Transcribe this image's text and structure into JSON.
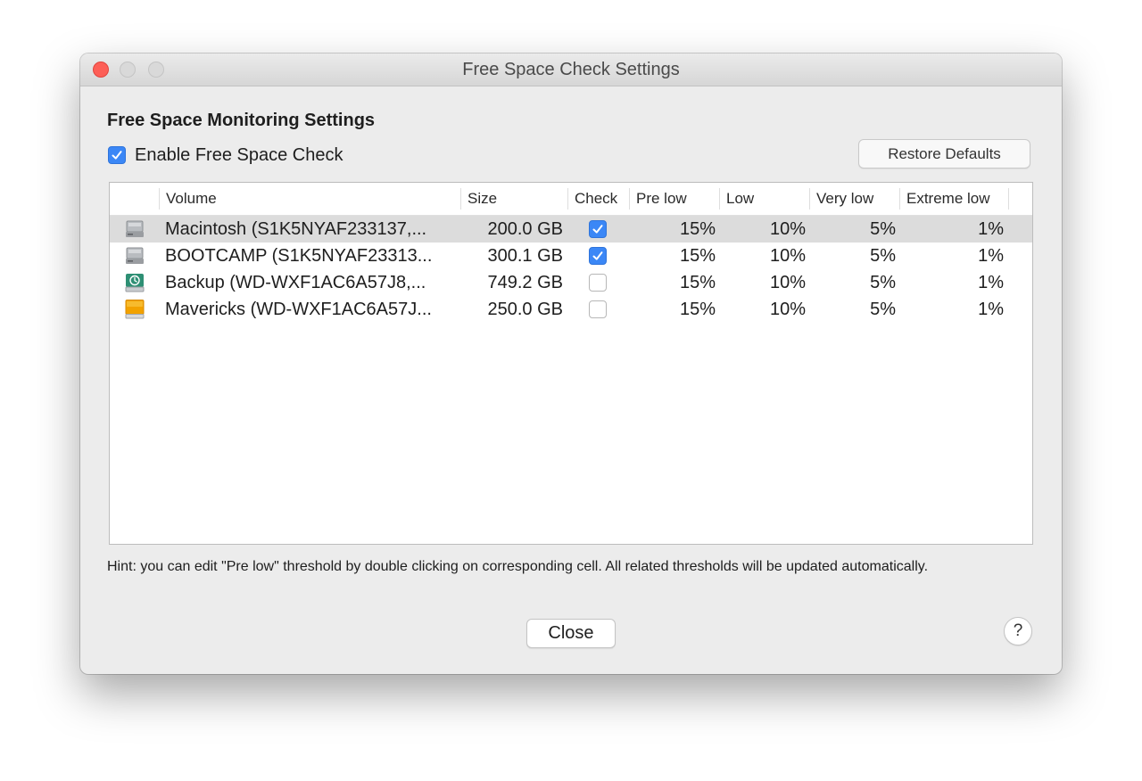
{
  "window": {
    "title": "Free Space Check Settings"
  },
  "section_title": "Free Space Monitoring Settings",
  "enable_check": {
    "label": "Enable Free Space Check",
    "checked": true
  },
  "restore_defaults_label": "Restore Defaults",
  "table": {
    "columns": [
      "",
      "Volume",
      "Size",
      "Check",
      "Pre low",
      "Low",
      "Very low",
      "Extreme low"
    ],
    "rows": [
      {
        "icon": "internal-drive-icon",
        "volume": "Macintosh (S1K5NYAF233137,...",
        "size": "200.0 GB",
        "check": true,
        "pre_low": "15%",
        "low": "10%",
        "very_low": "5%",
        "extreme_low": "1%",
        "selected": true
      },
      {
        "icon": "internal-drive-icon",
        "volume": "BOOTCAMP (S1K5NYAF23313...",
        "size": "300.1 GB",
        "check": true,
        "pre_low": "15%",
        "low": "10%",
        "very_low": "5%",
        "extreme_low": "1%",
        "selected": false
      },
      {
        "icon": "time-machine-drive-icon",
        "volume": "Backup (WD-WXF1AC6A57J8,...",
        "size": "749.2 GB",
        "check": false,
        "pre_low": "15%",
        "low": "10%",
        "very_low": "5%",
        "extreme_low": "1%",
        "selected": false
      },
      {
        "icon": "external-drive-icon",
        "volume": "Mavericks (WD-WXF1AC6A57J...",
        "size": "250.0 GB",
        "check": false,
        "pre_low": "15%",
        "low": "10%",
        "very_low": "5%",
        "extreme_low": "1%",
        "selected": false
      }
    ]
  },
  "hint": "Hint: you can edit \"Pre low\" threshold by double clicking on corresponding cell. All related thresholds will be updated automatically.",
  "close_label": "Close",
  "help_label": "?",
  "colors": {
    "accent": "#3b87f6",
    "selection": "#dcdcdc",
    "close_light": "#fd5f57"
  }
}
